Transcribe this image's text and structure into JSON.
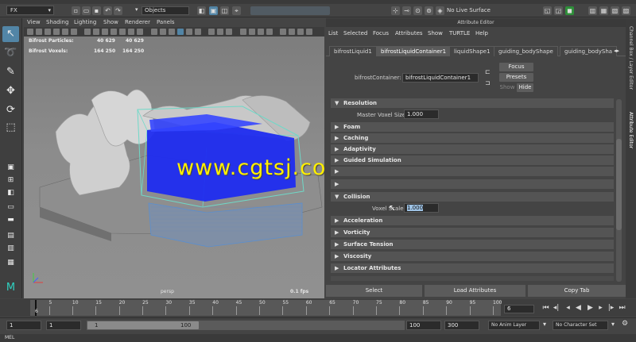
{
  "status_bar": {
    "mode": "FX",
    "selection_mode": "Objects",
    "live_surface": "No Live Surface"
  },
  "viewport": {
    "menu": [
      "View",
      "Shading",
      "Lighting",
      "Show",
      "Renderer",
      "Panels"
    ],
    "hud": {
      "particles_label": "Bifrost Particles:",
      "particles_values": [
        "40 629",
        "40 629"
      ],
      "voxels_label": "Bifrost Voxels:",
      "voxels_values": [
        "164 250",
        "164 250"
      ]
    },
    "camera_label": "persp",
    "fps": "0.1 fps",
    "watermark": "www.cgtsj.com"
  },
  "attribute_editor": {
    "title": "Attribute Editor",
    "menu": [
      "List",
      "Selected",
      "Focus",
      "Attributes",
      "Show",
      "TURTLE",
      "Help"
    ],
    "tabs": [
      "bifrostLiquid1",
      "bifrostLiquidContainer1",
      "liquidShape1",
      "guiding_bodyShape",
      "guiding_bodySha"
    ],
    "active_tab": 1,
    "node_label": "bifrostContainer:",
    "node_value": "bifrostLiquidContainer1",
    "focus_button": "Focus",
    "presets_button": "Presets",
    "show_label": "Show",
    "hide_button": "Hide",
    "sections": {
      "resolution": "Resolution",
      "master_voxel_size_label": "Master Voxel Size",
      "master_voxel_size_value": "1.000",
      "foam": "Foam",
      "caching": "Caching",
      "adaptivity": "Adaptivity",
      "guided_simulation": "Guided Simulation",
      "collision": "Collision",
      "voxel_scale_label": "Voxel Scale",
      "voxel_scale_value": "1.000",
      "acceleration": "Acceleration",
      "vorticity": "Vorticity",
      "surface_tension": "Surface Tension",
      "viscosity": "Viscosity",
      "locator_attributes": "Locator Attributes"
    },
    "side_labels": [
      "Channel Box / Layer Editor",
      "Attribute Editor"
    ],
    "bottom_buttons": [
      "Select",
      "Load Attributes",
      "Copy Tab"
    ]
  },
  "time_slider": {
    "ticks": [
      "5",
      "10",
      "15",
      "20",
      "25",
      "30",
      "35",
      "40",
      "45",
      "50",
      "55",
      "60",
      "65",
      "70",
      "75",
      "80",
      "85",
      "90",
      "95",
      "100"
    ],
    "current_frame_marker": "6",
    "current_frame": "6"
  },
  "range_slider": {
    "start": "1",
    "playback_start": "1",
    "range_start_label": "1",
    "range_end_label": "100",
    "playback_end": "100",
    "end": "300",
    "anim_layer": "No Anim Layer",
    "character_set": "No Character Set"
  },
  "command_line": {
    "label": "MEL"
  },
  "colors": {
    "accent": "#5285a6",
    "liquid": "#1f2cf0",
    "container": "#6fd9c8",
    "watermark": "#ffef00"
  }
}
